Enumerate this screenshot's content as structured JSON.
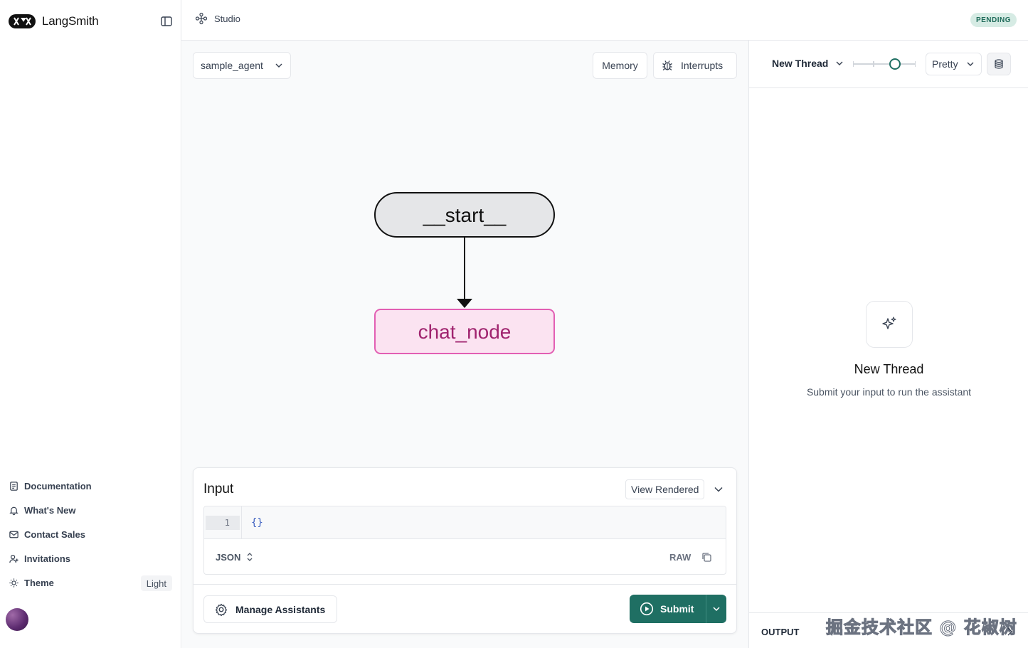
{
  "app": {
    "brand": "LangSmith"
  },
  "sidebar": {
    "items": [
      {
        "label": "Documentation"
      },
      {
        "label": "What's New"
      },
      {
        "label": "Contact Sales"
      },
      {
        "label": "Invitations"
      },
      {
        "label": "Theme",
        "value": "Light"
      }
    ]
  },
  "topbar": {
    "breadcrumb": "Studio",
    "status": "PENDING"
  },
  "canvas": {
    "assistant": "sample_agent",
    "memory_label": "Memory",
    "interrupts_label": "Interrupts",
    "graph": {
      "nodes": [
        {
          "label": "__start__"
        },
        {
          "label": "chat_node"
        }
      ]
    }
  },
  "input": {
    "title": "Input",
    "view_mode": "View Rendered",
    "line_number": "1",
    "code": "{}",
    "format": "JSON",
    "raw_label": "RAW",
    "manage_label": "Manage Assistants",
    "submit_label": "Submit"
  },
  "right_panel": {
    "thread": "New Thread",
    "render_mode": "Pretty",
    "empty_title": "New Thread",
    "empty_subtitle": "Submit your input to run the assistant",
    "output_label": "OUTPUT",
    "watermark": "掘金技术社区 @ 花椒树"
  },
  "colors": {
    "accent": "#1f6f63",
    "start_node_fill": "#e5e6e8",
    "chat_node_fill": "#fbe3f1",
    "chat_node_stroke": "#e25fb3",
    "chat_node_text": "#a0246f"
  }
}
